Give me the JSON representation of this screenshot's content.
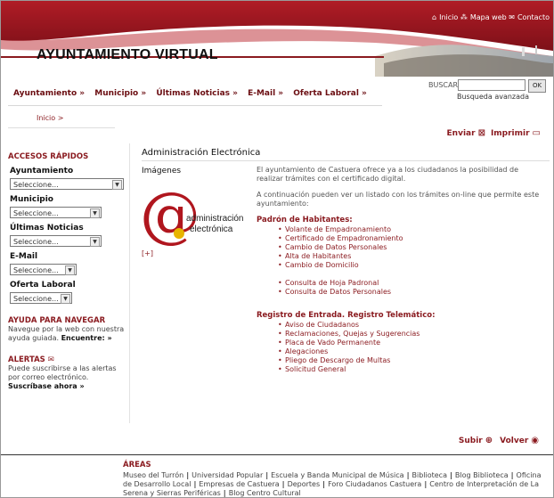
{
  "header": {
    "title": "AYUNTAMIENTO VIRTUAL",
    "top_links": [
      "Inicio",
      "Mapa web",
      "Contacto"
    ],
    "colors": {
      "primary": "#8a1a1f",
      "banner": "#9b1a22"
    }
  },
  "nav": {
    "items": [
      "Ayuntamiento »",
      "Municipio »",
      "Últimas Noticias »",
      "E-Mail »",
      "Oferta Laboral »"
    ]
  },
  "search": {
    "label": "BUSCAR",
    "value": "",
    "button": "OK",
    "advanced": "Busqueda avanzada"
  },
  "breadcrumb": "Inicio >",
  "actions": {
    "send": "Enviar",
    "print": "Imprimir",
    "up": "Subir",
    "back": "Volver"
  },
  "sidebar": {
    "quick_access_title": "ACCESOS RÁPIDOS",
    "selects": [
      {
        "label": "Ayuntamiento",
        "value": "Seleccione..."
      },
      {
        "label": "Municipio",
        "value": "Seleccione..."
      },
      {
        "label": "Últimas Noticias",
        "value": "Seleccione..."
      },
      {
        "label": "E-Mail",
        "value": "Seleccione..."
      },
      {
        "label": "Oferta Laboral",
        "value": "Seleccione..."
      }
    ],
    "help": {
      "title": "AYUDA PARA NAVEGAR",
      "text": "Navegue por la web con nuestra ayuda guiada.",
      "link": "Encuentre: »"
    },
    "alerts": {
      "title": "ALERTAS",
      "text": "Puede suscribirse a las alertas por correo electrónico.",
      "link": "Suscríbase ahora »"
    }
  },
  "main": {
    "title": "Administración Electrónica",
    "images_label": "Imágenes",
    "logo_text": [
      "administración",
      "electrónica"
    ],
    "expand": "[+]",
    "intro": "El ayuntamiento de Castuera ofrece ya a los ciudadanos la posibilidad de realizar trámites con el certificado digital.",
    "intro2": "A continuación pueden ver un listado con los trámites on-line que permite este ayuntamiento:",
    "group1_title": "Padrón de Habitantes:",
    "group1_items": [
      "Volante de Empadronamiento",
      "Certificado de Empadronamiento",
      "Cambio de Datos Personales",
      "Alta de Habitantes",
      "Cambio de Domicilio"
    ],
    "group1b_items": [
      "Consulta de Hoja Padronal",
      "Consulta de Datos Personales"
    ],
    "group2_title": "Registro de Entrada. Registro Telemático:",
    "group2_items": [
      "Aviso de Ciudadanos",
      "Reclamaciones, Quejas y Sugerencias",
      "Placa de Vado Permanente",
      "Alegaciones",
      "Pliego de Descargo de Multas",
      "Solicitud General"
    ]
  },
  "footer": {
    "areas_title": "ÁREAS",
    "areas": [
      "Museo del Turrón",
      "Universidad Popular",
      "Escuela y Banda Municipal de Música",
      "Biblioteca",
      "Blog Biblioteca",
      "Oficina de Desarrollo Local",
      "Empresas de Castuera",
      "Deportes",
      "Foro Ciudadanos Castuera",
      "Centro de Interpretación de La Serena y Sierras Periféricas",
      "Blog Centro Cultural"
    ]
  }
}
